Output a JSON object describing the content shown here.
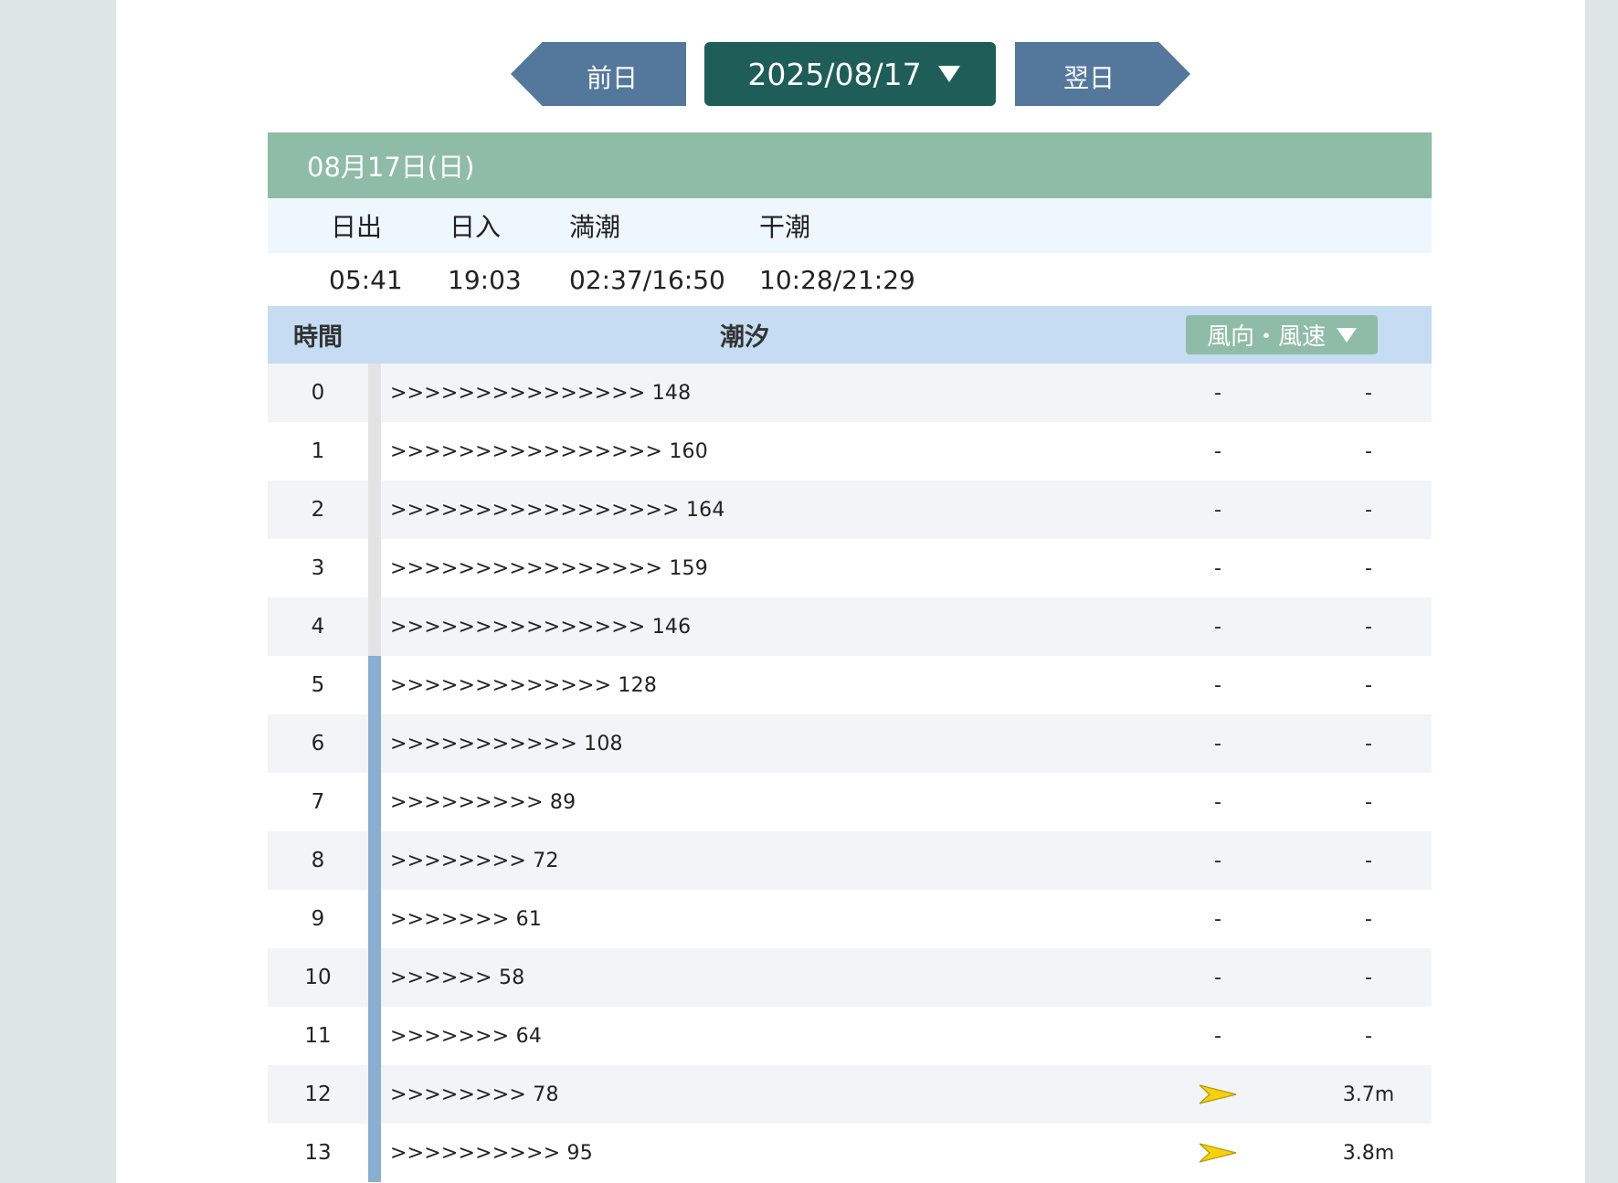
{
  "nav": {
    "prev_label": "前日",
    "next_label": "翌日",
    "date_value": "2025/08/17"
  },
  "day": {
    "title": "08月17日(日)",
    "labels": {
      "sunrise": "日出",
      "sunset": "日入",
      "high_tide": "満潮",
      "low_tide": "干潮"
    },
    "values": {
      "sunrise": "05:41",
      "sunset": "19:03",
      "high_tide": "02:37/16:50",
      "low_tide": "10:28/21:29"
    }
  },
  "table": {
    "headers": {
      "time": "時間",
      "tide": "潮汐",
      "wind": "風向・風速"
    },
    "rows": [
      {
        "hour": "0",
        "tide": ">>>>>>>>>>>>>>> 148",
        "wind_dir": "-",
        "wind_speed": "-",
        "bar": "gray"
      },
      {
        "hour": "1",
        "tide": ">>>>>>>>>>>>>>>> 160",
        "wind_dir": "-",
        "wind_speed": "-",
        "bar": "gray"
      },
      {
        "hour": "2",
        "tide": ">>>>>>>>>>>>>>>>> 164",
        "wind_dir": "-",
        "wind_speed": "-",
        "bar": "gray"
      },
      {
        "hour": "3",
        "tide": ">>>>>>>>>>>>>>>> 159",
        "wind_dir": "-",
        "wind_speed": "-",
        "bar": "gray"
      },
      {
        "hour": "4",
        "tide": ">>>>>>>>>>>>>>> 146",
        "wind_dir": "-",
        "wind_speed": "-",
        "bar": "gray"
      },
      {
        "hour": "5",
        "tide": ">>>>>>>>>>>>> 128",
        "wind_dir": "-",
        "wind_speed": "-",
        "bar": "blue"
      },
      {
        "hour": "6",
        "tide": ">>>>>>>>>>> 108",
        "wind_dir": "-",
        "wind_speed": "-",
        "bar": "blue"
      },
      {
        "hour": "7",
        "tide": ">>>>>>>>> 89",
        "wind_dir": "-",
        "wind_speed": "-",
        "bar": "blue"
      },
      {
        "hour": "8",
        "tide": ">>>>>>>> 72",
        "wind_dir": "-",
        "wind_speed": "-",
        "bar": "blue"
      },
      {
        "hour": "9",
        "tide": ">>>>>>> 61",
        "wind_dir": "-",
        "wind_speed": "-",
        "bar": "blue"
      },
      {
        "hour": "10",
        "tide": ">>>>>> 58",
        "wind_dir": "-",
        "wind_speed": "-",
        "bar": "blue"
      },
      {
        "hour": "11",
        "tide": ">>>>>>> 64",
        "wind_dir": "-",
        "wind_speed": "-",
        "bar": "blue"
      },
      {
        "hour": "12",
        "tide": ">>>>>>>> 78",
        "wind_dir": "",
        "wind_icon": "wind-arrow-icon",
        "wind_speed": "3.7m",
        "bar": "blue"
      },
      {
        "hour": "13",
        "tide": ">>>>>>>>>> 95",
        "wind_dir": "",
        "wind_icon": "wind-arrow-icon",
        "wind_speed": "3.8m",
        "bar": "blue"
      }
    ]
  },
  "colors": {
    "nav_arrow": "#54779c",
    "date_select": "#1f5e58",
    "day_header": "#8fbca7",
    "table_header": "#c5dcf3",
    "bar_gray": "#e3e3e3",
    "bar_blue": "#8aaed0",
    "wind_arrow": "#f5d10f"
  }
}
